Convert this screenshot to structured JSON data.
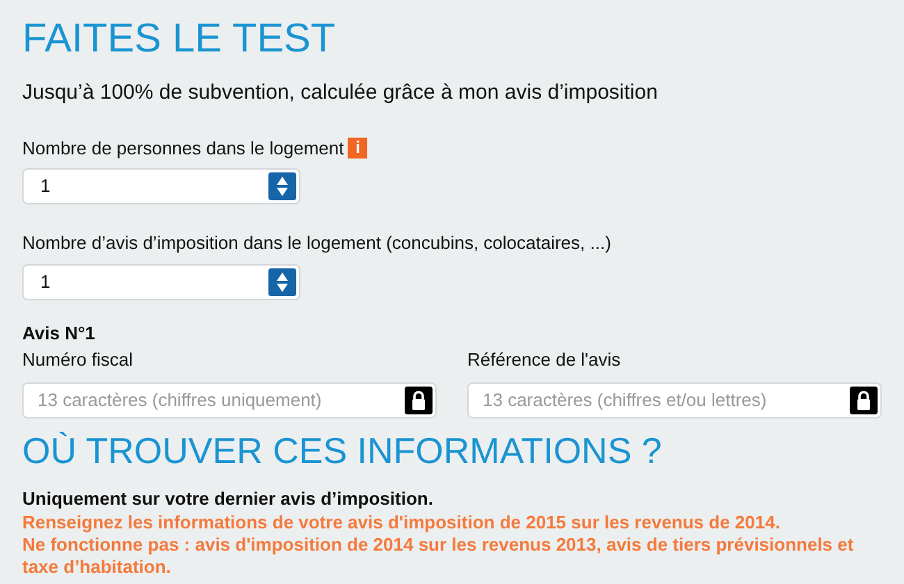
{
  "title": "FAITES LE TEST",
  "subtitle": "Jusqu’à 100% de subvention, calculée grâce à mon avis d’imposition",
  "selects": [
    {
      "label": "Nombre de personnes dans le logement",
      "info": "i",
      "value": "1"
    },
    {
      "label": "Nombre d’avis d’imposition dans le logement (concubins, colocataires, ...)",
      "value": "1"
    }
  ],
  "avis": {
    "heading": "Avis N°1",
    "fields": [
      {
        "label": "Numéro fiscal",
        "placeholder": "13 caractères (chiffres uniquement)"
      },
      {
        "label": "Référence de l'avis",
        "placeholder": "13 caractères (chiffres et/ou lettres)"
      }
    ]
  },
  "where": {
    "heading": "OÙ TROUVER CES INFORMATIONS ?",
    "lead": "Uniquement sur votre dernier avis d’imposition.",
    "notes": [
      "Renseignez les informations de votre avis d'imposition de 2015 sur les revenus de 2014.",
      "Ne fonctionne pas : avis d'imposition de 2014 sur les revenus 2013, avis de tiers prévisionnels et taxe d’habitation."
    ]
  }
}
